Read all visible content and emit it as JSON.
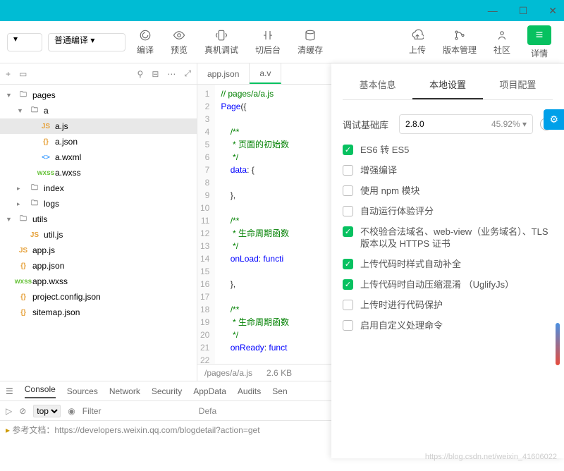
{
  "window": {
    "min": "—",
    "max": "☐",
    "close": "✕"
  },
  "toolbar": {
    "compile_mode": "普通编译",
    "compile": "编译",
    "preview": "预览",
    "remote": "真机调试",
    "back": "切后台",
    "clear": "清缓存",
    "upload": "上传",
    "version": "版本管理",
    "community": "社区",
    "detail": "详情"
  },
  "tree": {
    "pages": "pages",
    "a": "a",
    "ajs": "a.js",
    "ajson": "a.json",
    "awxml": "a.wxml",
    "awxss": "a.wxss",
    "index": "index",
    "logs": "logs",
    "utils": "utils",
    "utiljs": "util.js",
    "appjs": "app.js",
    "appjson": "app.json",
    "appwxss": "app.wxss",
    "projconf": "project.config.json",
    "sitemap": "sitemap.json"
  },
  "editor": {
    "tab1": "app.json",
    "tab2": "a.v",
    "path": "/pages/a/a.js",
    "size": "2.6 KB",
    "lines": [
      "// pages/a/a.js",
      "Page({",
      "",
      "    /**",
      "     * 页面的初始数",
      "     */",
      "    data: {",
      "",
      "    },",
      "",
      "    /**",
      "     * 生命周期函数",
      "     */",
      "    onLoad: functi",
      "",
      "    },",
      "",
      "    /**",
      "     * 生命周期函数",
      "     */",
      "    onReady: funct",
      "",
      "    },",
      "",
      "    /**"
    ]
  },
  "devtools": {
    "console": "Console",
    "sources": "Sources",
    "network": "Network",
    "security": "Security",
    "appdata": "AppData",
    "audits": "Audits",
    "sen": "Sen",
    "top": "top",
    "filter": "Filter",
    "def": "Defa",
    "msg": "参考文档：https://developers.weixin.qq.com/blogdetail?action=get"
  },
  "panel": {
    "tab1": "基本信息",
    "tab2": "本地设置",
    "tab3": "项目配置",
    "baselib_label": "调试基础库",
    "baselib_val": "2.8.0",
    "baselib_pct": "45.92%",
    "help": "?",
    "checks": [
      {
        "on": true,
        "label": "ES6 转 ES5"
      },
      {
        "on": false,
        "label": "增强编译"
      },
      {
        "on": false,
        "label": "使用 npm 模块"
      },
      {
        "on": false,
        "label": "自动运行体验评分"
      },
      {
        "on": true,
        "label": "不校验合法域名、web-view（业务域名）、TLS 版本以及 HTTPS 证书"
      },
      {
        "on": true,
        "label": "上传代码时样式自动补全"
      },
      {
        "on": true,
        "label": "上传代码时自动压缩混淆 （UglifyJs）"
      },
      {
        "on": false,
        "label": "上传时进行代码保护"
      },
      {
        "on": false,
        "label": "启用自定义处理命令"
      }
    ]
  },
  "footer": "https://blog.csdn.net/weixin_41606022",
  "badge": "⚙"
}
